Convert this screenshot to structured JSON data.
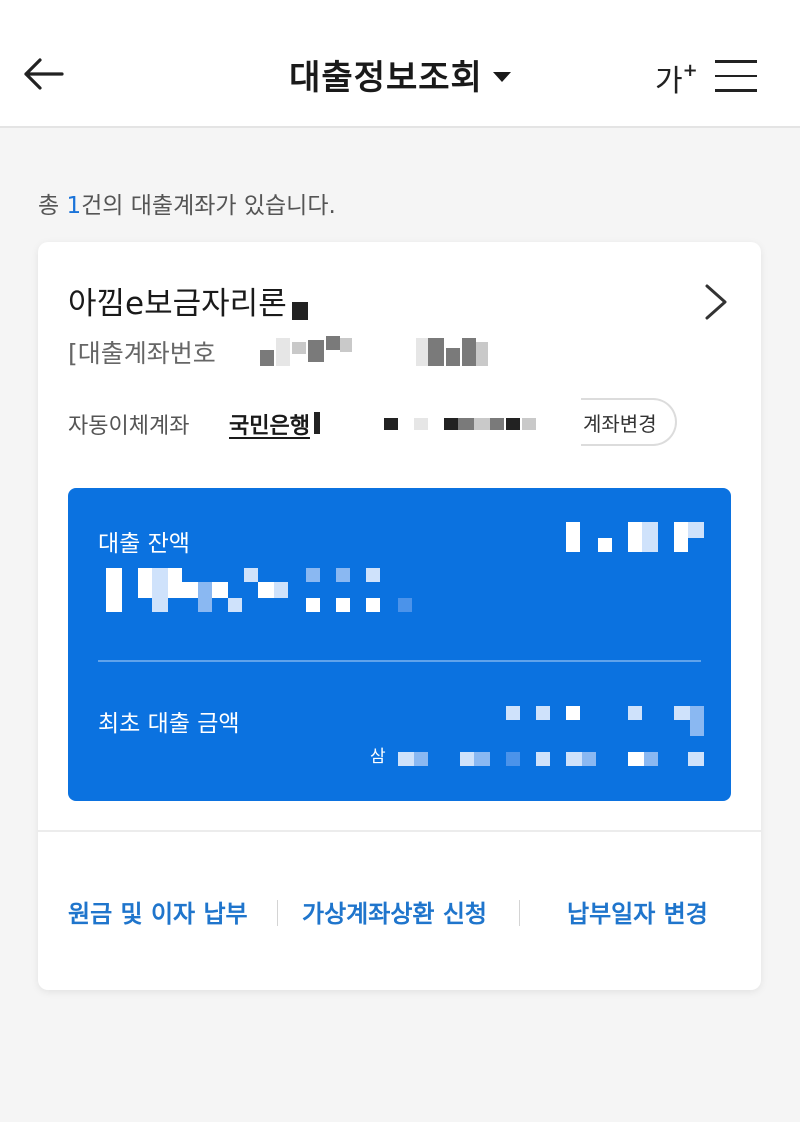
{
  "header": {
    "title": "대출정보조회",
    "font_size_label": "가",
    "font_size_plus": "+"
  },
  "summary": {
    "prefix": "총 ",
    "count": "1",
    "suffix": "건의 대출계좌가 있습니다."
  },
  "loan": {
    "product_name": "아낌e보금자리론",
    "account_label": "[대출계좌번호",
    "autopay_label": "자동이체계좌",
    "autopay_bank": "국민은행",
    "change_account_button": "계좌변경",
    "balance_label": "대출 잔액",
    "initial_amount_label": "최초 대출 금액",
    "amount_prefix": "삼"
  },
  "actions": {
    "pay_principal_interest": "원금 및 이자 납부",
    "virtual_account_repayment": "가상계좌상환 신청",
    "change_payment_date": "납부일자 변경"
  },
  "colors": {
    "accent": "#1a73d9",
    "loan_box": "#0b72e0",
    "action_link": "#1f75cc"
  }
}
